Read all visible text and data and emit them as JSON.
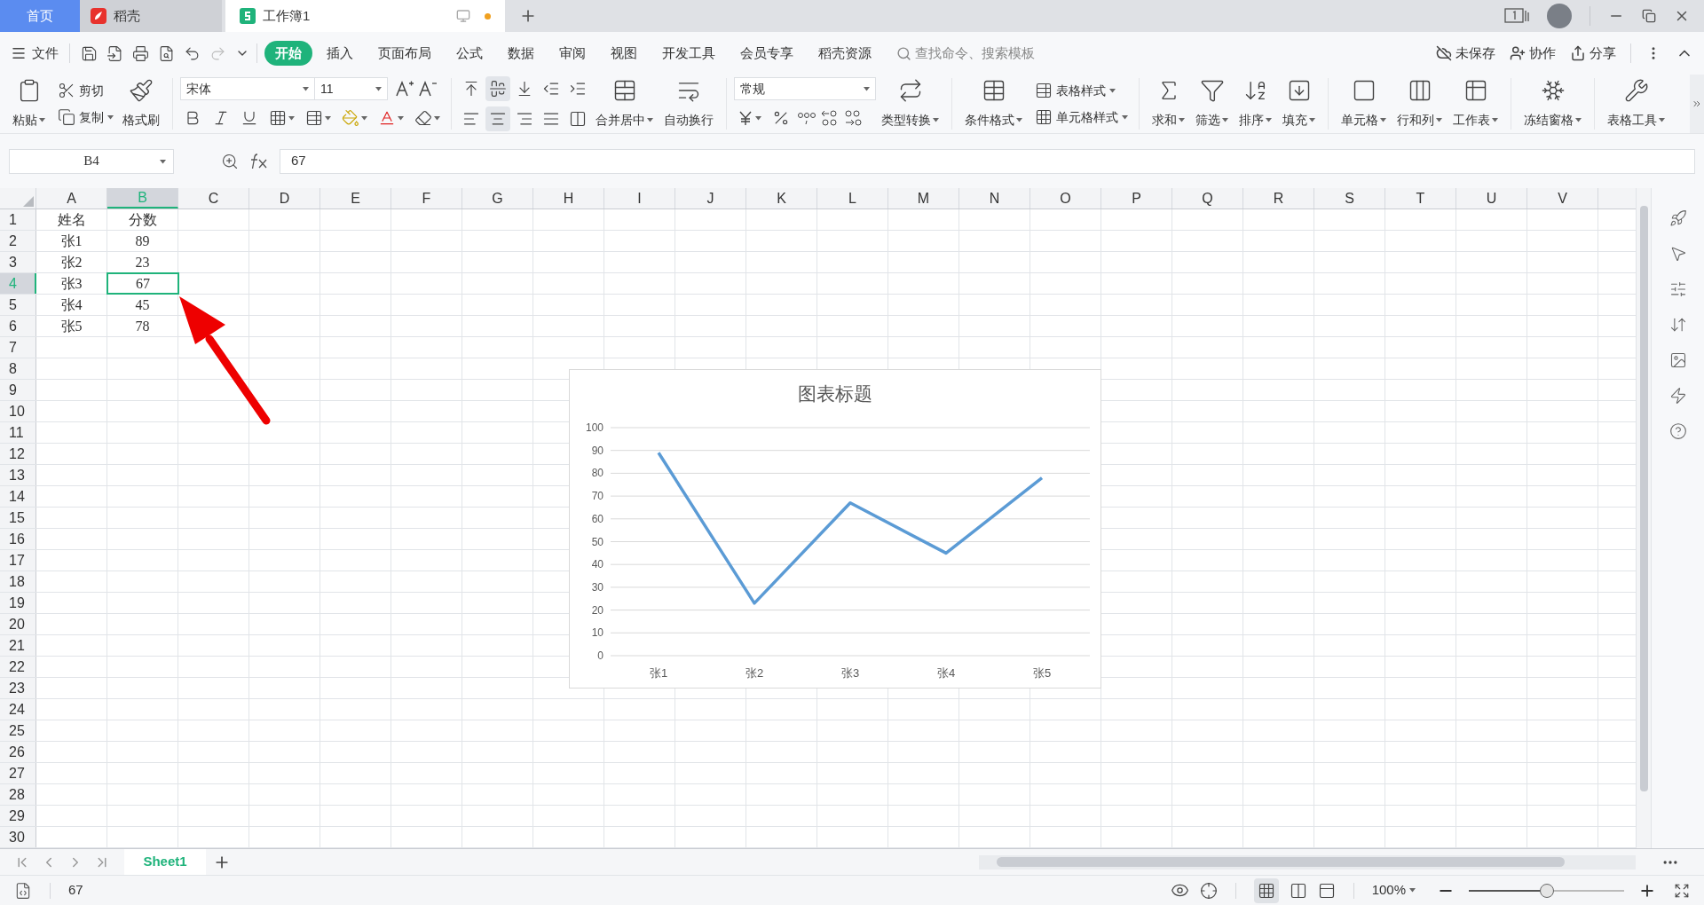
{
  "app_tabs": [
    {
      "label": "首页",
      "selected": false,
      "kind": "home"
    },
    {
      "label": "稻壳",
      "selected": false,
      "kind": "docer"
    },
    {
      "label": "工作簿1",
      "selected": true,
      "kind": "sheet"
    }
  ],
  "menu": {
    "file": "文件",
    "tabs": [
      {
        "label": "开始",
        "selected": true
      },
      {
        "label": "插入",
        "selected": false
      },
      {
        "label": "页面布局",
        "selected": false
      },
      {
        "label": "公式",
        "selected": false
      },
      {
        "label": "数据",
        "selected": false
      },
      {
        "label": "审阅",
        "selected": false
      },
      {
        "label": "视图",
        "selected": false
      },
      {
        "label": "开发工具",
        "selected": false
      },
      {
        "label": "会员专享",
        "selected": false
      },
      {
        "label": "稻壳资源",
        "selected": false
      }
    ],
    "search": {
      "placeholder": "查找命令、搜索模板"
    },
    "actions": [
      "未保存",
      "协作",
      "分享"
    ]
  },
  "ribbon": {
    "clipboard": {
      "paste": "粘贴",
      "cut": "剪切",
      "copy": "复制",
      "format_painter": "格式刷"
    },
    "font": {
      "name": "宋体",
      "size": "11"
    },
    "alignment": {
      "merge": "合并居中",
      "wrap": "自动换行"
    },
    "number": {
      "format": "常规",
      "convert": "类型转换"
    },
    "styles": {
      "conditional": "条件格式",
      "table_style": "表格样式",
      "cell_style": "单元格样式"
    },
    "tools": [
      "求和",
      "筛选",
      "排序",
      "填充",
      "单元格",
      "行和列",
      "工作表",
      "冻结窗格",
      "表格工具"
    ]
  },
  "formula_bar": {
    "name_box": "B4",
    "value": "67"
  },
  "sheet": {
    "columns": [
      {
        "label": "A",
        "selected": false
      },
      {
        "label": "B",
        "selected": true
      },
      {
        "label": "C",
        "selected": false
      },
      {
        "label": "D",
        "selected": false
      },
      {
        "label": "E",
        "selected": false
      },
      {
        "label": "F",
        "selected": false
      },
      {
        "label": "G",
        "selected": false
      },
      {
        "label": "H",
        "selected": false
      },
      {
        "label": "I",
        "selected": false
      },
      {
        "label": "J",
        "selected": false
      },
      {
        "label": "K",
        "selected": false
      },
      {
        "label": "L",
        "selected": false
      },
      {
        "label": "M",
        "selected": false
      },
      {
        "label": "N",
        "selected": false
      },
      {
        "label": "O",
        "selected": false
      },
      {
        "label": "P",
        "selected": false
      },
      {
        "label": "Q",
        "selected": false
      },
      {
        "label": "R",
        "selected": false
      },
      {
        "label": "S",
        "selected": false
      },
      {
        "label": "T",
        "selected": false
      },
      {
        "label": "U",
        "selected": false
      },
      {
        "label": "V",
        "selected": false
      }
    ],
    "rows": [
      {
        "label": "1",
        "selected": false,
        "cells": [
          "姓名",
          "分数"
        ]
      },
      {
        "label": "2",
        "selected": false,
        "cells": [
          "张1",
          "89"
        ]
      },
      {
        "label": "3",
        "selected": false,
        "cells": [
          "张2",
          "23"
        ]
      },
      {
        "label": "4",
        "selected": true,
        "cells": [
          "张3",
          "67"
        ]
      },
      {
        "label": "5",
        "selected": false,
        "cells": [
          "张4",
          "45"
        ]
      },
      {
        "label": "6",
        "selected": false,
        "cells": [
          "张5",
          "78"
        ]
      },
      {
        "label": "7",
        "selected": false
      },
      {
        "label": "8",
        "selected": false
      },
      {
        "label": "9",
        "selected": false
      },
      {
        "label": "10",
        "selected": false
      },
      {
        "label": "11",
        "selected": false
      },
      {
        "label": "12",
        "selected": false
      },
      {
        "label": "13",
        "selected": false
      },
      {
        "label": "14",
        "selected": false
      },
      {
        "label": "15",
        "selected": false
      },
      {
        "label": "16",
        "selected": false
      },
      {
        "label": "17",
        "selected": false
      },
      {
        "label": "18",
        "selected": false
      },
      {
        "label": "19",
        "selected": false
      },
      {
        "label": "20",
        "selected": false
      },
      {
        "label": "21",
        "selected": false
      },
      {
        "label": "22",
        "selected": false
      },
      {
        "label": "23",
        "selected": false
      },
      {
        "label": "24",
        "selected": false
      },
      {
        "label": "25",
        "selected": false
      },
      {
        "label": "26",
        "selected": false
      },
      {
        "label": "27",
        "selected": false
      },
      {
        "label": "28",
        "selected": false
      },
      {
        "label": "29",
        "selected": false
      },
      {
        "label": "30",
        "selected": false
      }
    ]
  },
  "chart": {
    "chart_data": {
      "type": "line",
      "title": "图表标题",
      "categories": [
        "张1",
        "张2",
        "张3",
        "张4",
        "张5"
      ],
      "series": [
        {
          "color": "#5b9bd5",
          "values": [
            89,
            23,
            67,
            45,
            78
          ]
        }
      ],
      "grid": true,
      "ylim": [
        0,
        100
      ],
      "yticks": [
        0,
        10,
        20,
        30,
        40,
        50,
        60,
        70,
        80,
        90,
        100
      ]
    }
  },
  "sheet_tabs": [
    {
      "label": "Sheet1",
      "selected": true
    }
  ],
  "status_bar": {
    "value": "67",
    "zoom": "100%",
    "zoom_slider": {
      "level": 0.5
    }
  }
}
